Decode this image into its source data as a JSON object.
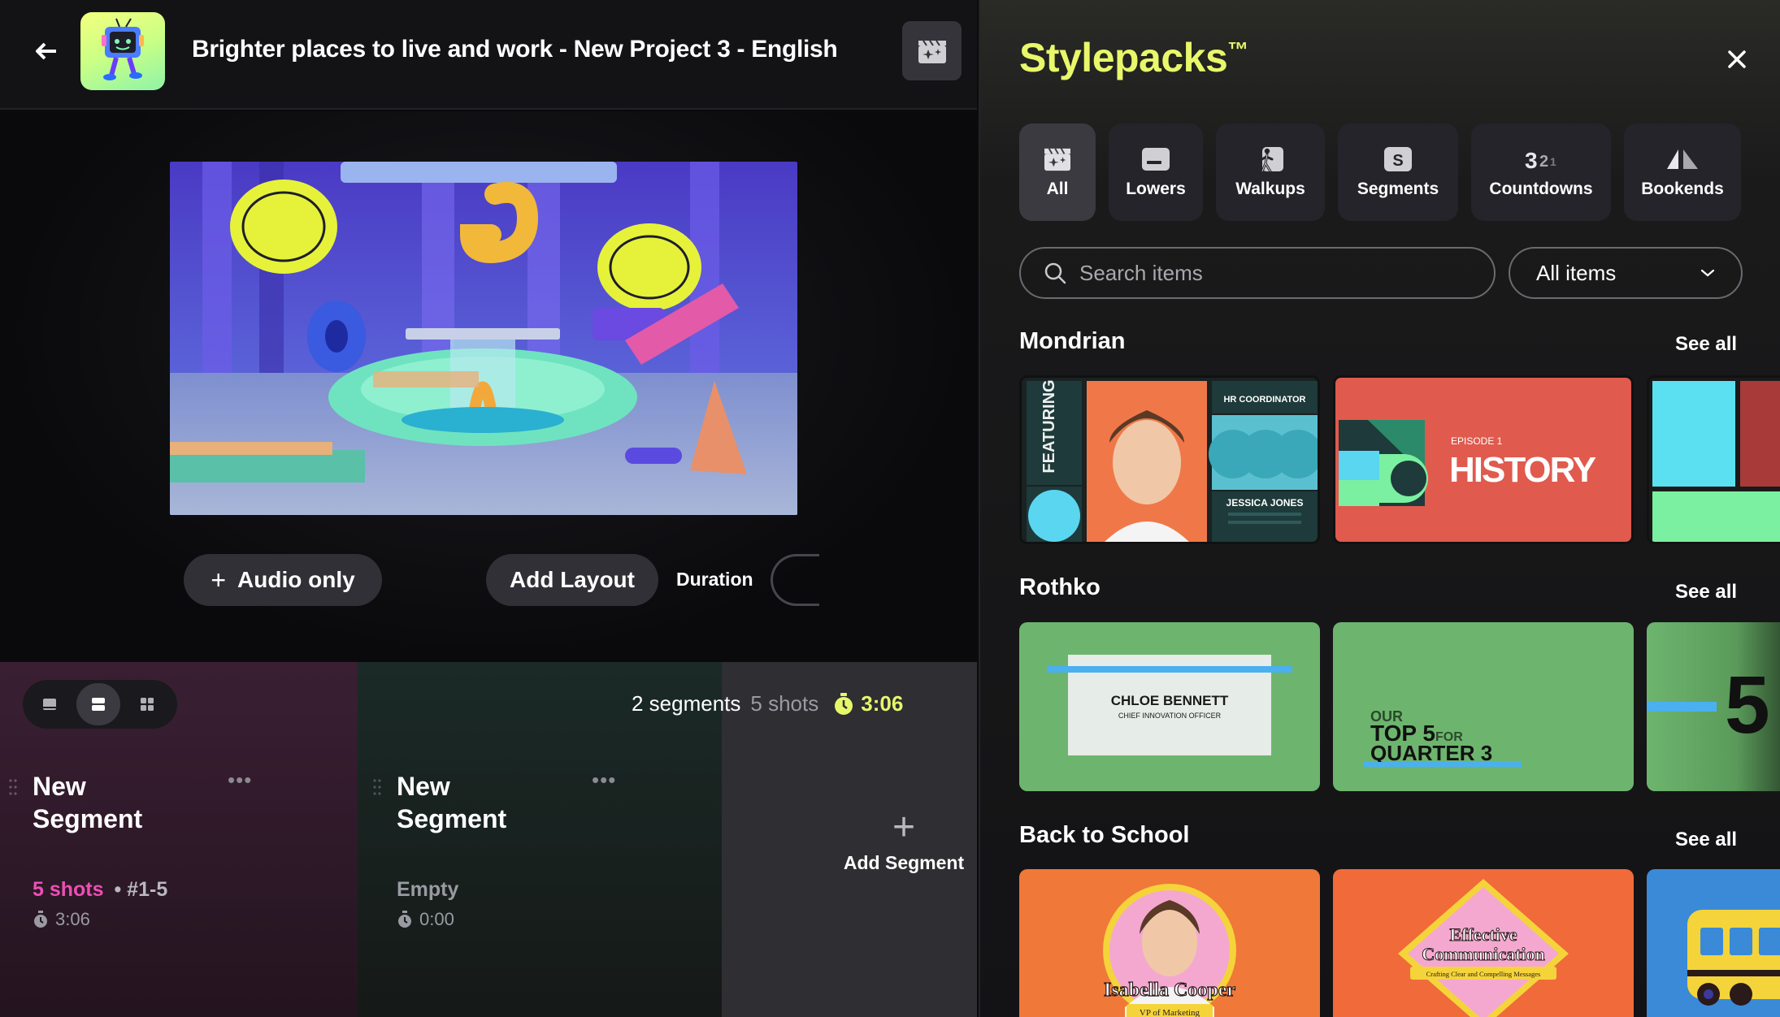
{
  "header": {
    "project_title": "Brighter places to live and work - New Project 3 - English"
  },
  "stage": {
    "audio_only_label": "Audio only",
    "add_layout_label": "Add Layout",
    "duration_label": "Duration"
  },
  "segments_bar": {
    "segments_count": "2 segments",
    "shots_count": "5 shots",
    "total_time": "3:06"
  },
  "segments": [
    {
      "name": "New Segment",
      "shots_text": "5 shots",
      "range_text": "• #1-5",
      "time": "3:06",
      "shots_color": "#ec4fb4"
    },
    {
      "name": "New Segment",
      "shots_text": "Empty",
      "range_text": "",
      "time": "0:00",
      "shots_color": "#9a9aa2"
    }
  ],
  "add_segment_label": "Add Segment",
  "panel": {
    "title": "Stylepacks",
    "trademark": "™",
    "categories": [
      {
        "label": "All",
        "icon": "clapperboard-sparkle-icon",
        "active": true
      },
      {
        "label": "Lowers",
        "icon": "lower-third-icon",
        "active": false
      },
      {
        "label": "Walkups",
        "icon": "walking-person-icon",
        "active": false
      },
      {
        "label": "Segments",
        "icon": "segment-s-icon",
        "active": false
      },
      {
        "label": "Countdowns",
        "icon": "countdown-321-icon",
        "active": false
      },
      {
        "label": "Bookends",
        "icon": "bookends-icon",
        "active": false
      }
    ],
    "search_placeholder": "Search items",
    "filter_value": "All items",
    "groups": [
      {
        "name": "Mondrian",
        "see_all": "See all"
      },
      {
        "name": "Rothko",
        "see_all": "See all"
      },
      {
        "name": "Back to School",
        "see_all": "See all"
      }
    ],
    "mondrian_cards": {
      "c1_featuring": "FEATURING",
      "c1_role": "HR COORDINATOR",
      "c1_name": "JESSICA JONES",
      "c2_episode": "EPISODE 1",
      "c2_title": "HISTORY"
    },
    "rothko_cards": {
      "c1_name": "CHLOE BENNETT",
      "c1_role": "CHIEF INNOVATION OFFICER",
      "c2_line1": "OUR",
      "c2_line2": "TOP 5",
      "c2_for": "FOR",
      "c2_line3": "QUARTER 3",
      "c3_digit": "5"
    },
    "school_cards": {
      "c1_name": "Isabella Cooper",
      "c1_role": "VP of Marketing",
      "c2_title1": "Effective",
      "c2_title2": "Communication",
      "c2_sub": "Crafting Clear and Compelling Messages"
    }
  },
  "colors": {
    "accent_yellow": "#e8f86a",
    "pink": "#ec4fb4",
    "mondrian_red": "#e05a4e",
    "rothko_green": "#6db56e",
    "school_orange": "#f07838"
  }
}
